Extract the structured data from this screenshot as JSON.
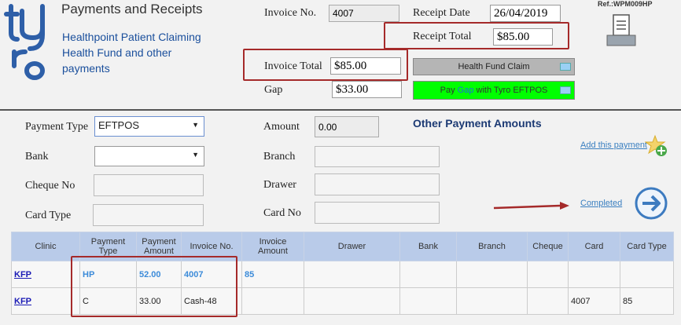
{
  "header": {
    "title": "Payments and Receipts",
    "subtitle_lines": [
      "Healthpoint Patient Claiming",
      "Health Fund and other",
      "payments"
    ],
    "ref": "Ref.:WPM009HP"
  },
  "invoice": {
    "invoice_no_label": "Invoice No.",
    "invoice_no_value": "4007",
    "receipt_date_label": "Receipt Date",
    "receipt_date_value": "26/04/2019",
    "receipt_total_label": "Receipt Total",
    "receipt_total_value": "$85.00",
    "invoice_total_label": "Invoice Total",
    "invoice_total_value": "$85.00",
    "gap_label": "Gap",
    "gap_value": "$33.00"
  },
  "buttons": {
    "health_fund_claim": "Health Fund Claim",
    "pay_gap_prefix": "Pay ",
    "pay_gap_highlight": "Gap",
    "pay_gap_suffix": " with Tyro EFTPOS"
  },
  "form": {
    "payment_type_label": "Payment Type",
    "payment_type_value": "EFTPOS",
    "bank_label": "Bank",
    "bank_value": "",
    "cheque_no_label": "Cheque No",
    "card_type_label": "Card Type",
    "amount_label": "Amount",
    "amount_value": "0.00",
    "branch_label": "Branch",
    "drawer_label": "Drawer",
    "card_no_label": "Card No",
    "other_payments_heading": "Other Payment Amounts",
    "add_payment_link": "Add this payment",
    "completed_link": "Completed"
  },
  "table": {
    "headers": [
      [
        "Clinic"
      ],
      [
        "Payment",
        "Type"
      ],
      [
        "Payment",
        "Amount"
      ],
      [
        "Invoice No."
      ],
      [
        "Invoice",
        "Amount"
      ],
      [
        "Drawer"
      ],
      [
        "Bank"
      ],
      [
        "Branch"
      ],
      [
        "Cheque"
      ],
      [
        "Card"
      ],
      [
        "Card Type"
      ]
    ],
    "rows": [
      [
        "KFP",
        "HP",
        "52.00",
        "4007",
        "85",
        "",
        "",
        "",
        "",
        "",
        ""
      ],
      [
        "KFP",
        "C",
        "33.00",
        "Cash-48",
        "",
        "",
        "",
        "",
        "",
        "4007",
        "85"
      ]
    ]
  },
  "colors": {
    "logo": "#2e5fa8",
    "title_blue": "#1a4f9c",
    "heading_navy": "#1c3a74",
    "highlight_red": "#a52a2a",
    "tyro_green": "#00ff00",
    "table_header": "#b9cbe9",
    "row_highlight_text": "#3c8bd9"
  }
}
